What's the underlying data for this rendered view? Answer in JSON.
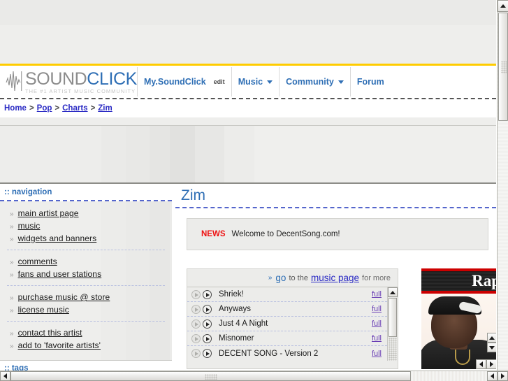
{
  "browser": {
    "vscroll_up_icon": "arrow-up-icon",
    "hscroll_left_icon": "arrow-left-icon",
    "hscroll_right_icon": "arrow-right-icon"
  },
  "header": {
    "logo": {
      "part1": "SOUND",
      "part2": "CLICK",
      "tagline": "THE #1 ARTIST MUSIC COMMUNITY",
      "wave_icon": "waveform-icon"
    },
    "menu": [
      {
        "label": "My.SoundClick",
        "caret": false,
        "small": false
      },
      {
        "label": "edit",
        "caret": false,
        "small": true
      },
      {
        "label": "Music",
        "caret": true,
        "small": false
      },
      {
        "label": "Community",
        "caret": true,
        "small": false
      },
      {
        "label": "Forum",
        "caret": false,
        "small": false
      }
    ]
  },
  "breadcrumb": {
    "items": [
      {
        "label": "Home",
        "link": false
      },
      {
        "label": "Pop",
        "link": true
      },
      {
        "label": "Charts",
        "link": true
      },
      {
        "label": "Zim",
        "link": true
      }
    ],
    "separator": ">"
  },
  "sidebar": {
    "title": ":: navigation",
    "groups": [
      {
        "items": [
          "main artist page",
          "music",
          "widgets and banners"
        ]
      },
      {
        "items": [
          "comments",
          "fans and user stations"
        ]
      },
      {
        "items": [
          "purchase music @ store",
          "license music"
        ]
      },
      {
        "items": [
          "contact this artist",
          "add to 'favorite artists'"
        ]
      }
    ],
    "bullet": "»",
    "tags_title": ":: tags"
  },
  "main": {
    "artist_name": "Zim",
    "news": {
      "label": "NEWS",
      "text": "Welcome to DecentSong.com!"
    },
    "music_box": {
      "header": {
        "chevron": "»",
        "pre": "go",
        "mid": "to the",
        "link": "music page",
        "post": "for more"
      },
      "songs": [
        {
          "title": "Shriek!",
          "full_label": "full"
        },
        {
          "title": "Anyways",
          "full_label": "full"
        },
        {
          "title": "Just 4 A Night",
          "full_label": "full"
        },
        {
          "title": "Misnomer",
          "full_label": "full"
        },
        {
          "title": "DECENT SONG - Version 2",
          "full_label": "full"
        }
      ],
      "play_icon": "play-icon",
      "preview_icon": "play-preview-icon",
      "scroll_up_icon": "arrow-up-icon"
    },
    "ad": {
      "banner_text": "Rap",
      "photo_alt": "rapper-photo",
      "scroll_up_icon": "arrow-up-icon",
      "scroll_down_icon": "arrow-down-icon",
      "scroll_left_icon": "arrow-left-icon",
      "scroll_right_icon": "arrow-right-icon"
    }
  },
  "colors": {
    "brand_blue": "#2f6fb5",
    "link_blue": "#2b2bc4",
    "visited_purple": "#6a3fb5",
    "news_red": "#ee1111",
    "accent_yellow": "#ffcc00",
    "page_grey": "#eeeeec"
  }
}
